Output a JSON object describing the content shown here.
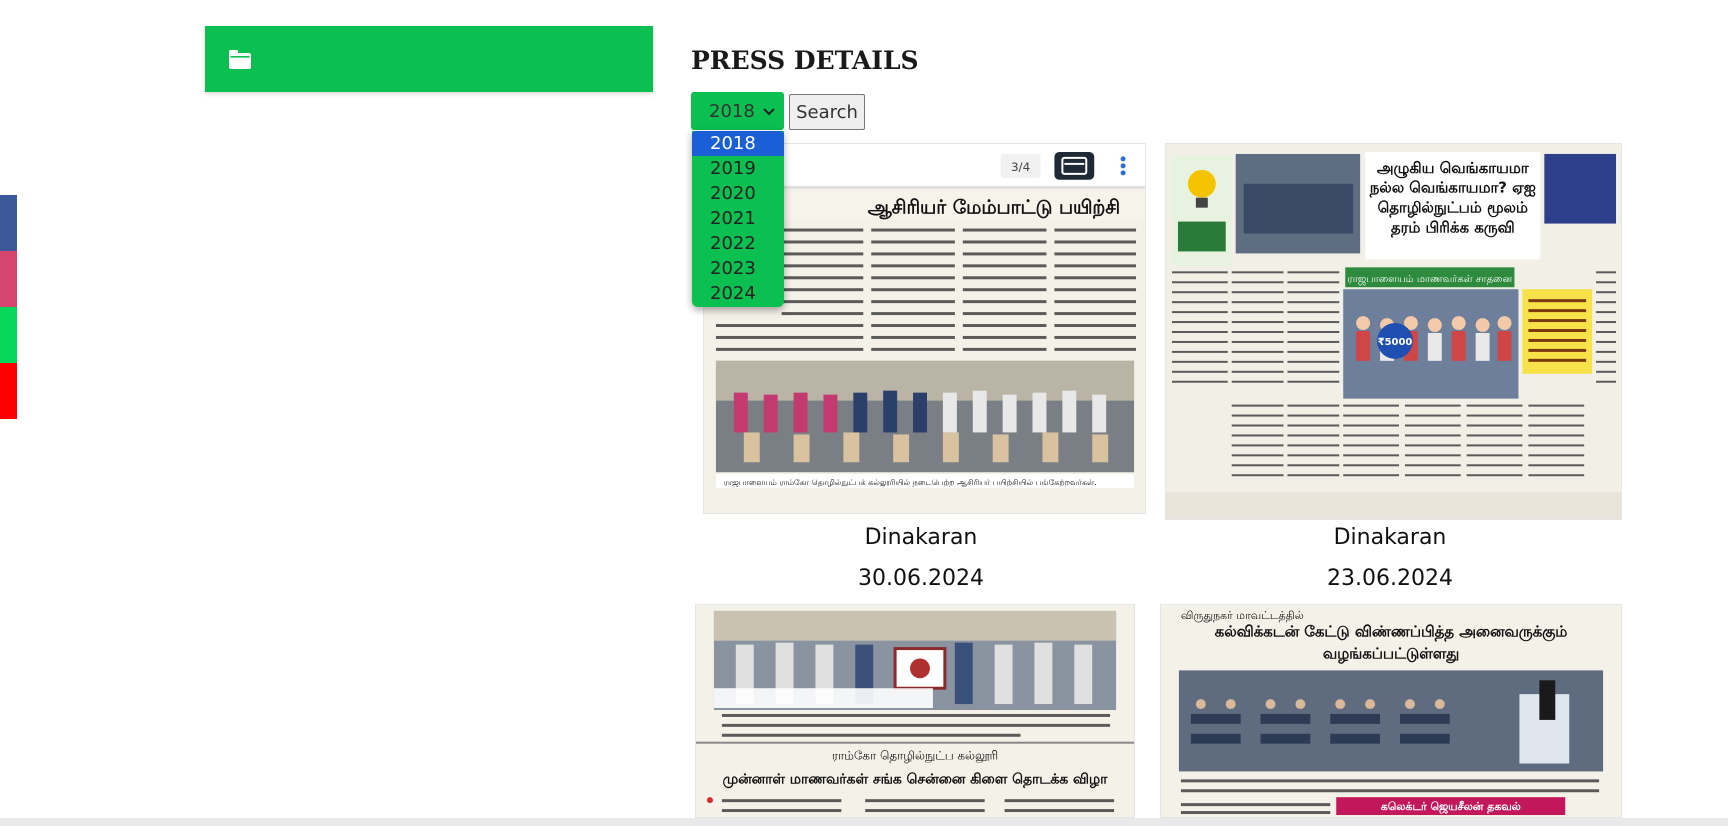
{
  "page": {
    "title": "PRESS DETAILS"
  },
  "colors": {
    "accent": "#0bbf50",
    "selected_option": "#1a5fd6"
  },
  "sidebar": {
    "icon": "folder-icon"
  },
  "filter": {
    "selected_year": "2018",
    "options": [
      "2018",
      "2019",
      "2020",
      "2021",
      "2022",
      "2023",
      "2024"
    ],
    "search_label": "Search"
  },
  "viewer": {
    "page_indicator": "3/4"
  },
  "press": [
    {
      "publication": "Dinakaran",
      "date": "30.06.2024",
      "headline": "ஆசிரியர் மேம்பாட்டு பயிற்சி",
      "caption": "ராஜபாளையம் ராம்கோ தொழில்நுட்பக் கல்லூரியில் நடைபெற்ற ஆசிரியர் பயிற்சியில் பங்கேற்றவர்கள்."
    },
    {
      "publication": "Dinakaran",
      "date": "23.06.2024",
      "headline": "அழுகிய வெங்காயமா நல்ல வெங்காயமா? ஏஐ தொழில்நுட்பம் மூலம் தரம் பிரிக்க கருவி",
      "subheadline": "ராஜபாளையம் மாணவர்கள் சாதனை",
      "badge": "₹5000"
    },
    {
      "headline": "ராம்கோ தொழில்நுட்ப கல்லூரி",
      "subheadline": "முன்னாள் மாணவர்கள் சங்க சென்னை கிளை தொடக்க விழா"
    },
    {
      "kicker": "விருதுநகர் மாவட்டத்தில்",
      "headline": "கல்விக்கடன் கேட்டு விண்ணப்பித்த அனைவருக்கும் வழங்கப்பட்டுள்ளது",
      "tag": "கலெக்டர் ஜெயசீலன் தகவல்"
    }
  ]
}
